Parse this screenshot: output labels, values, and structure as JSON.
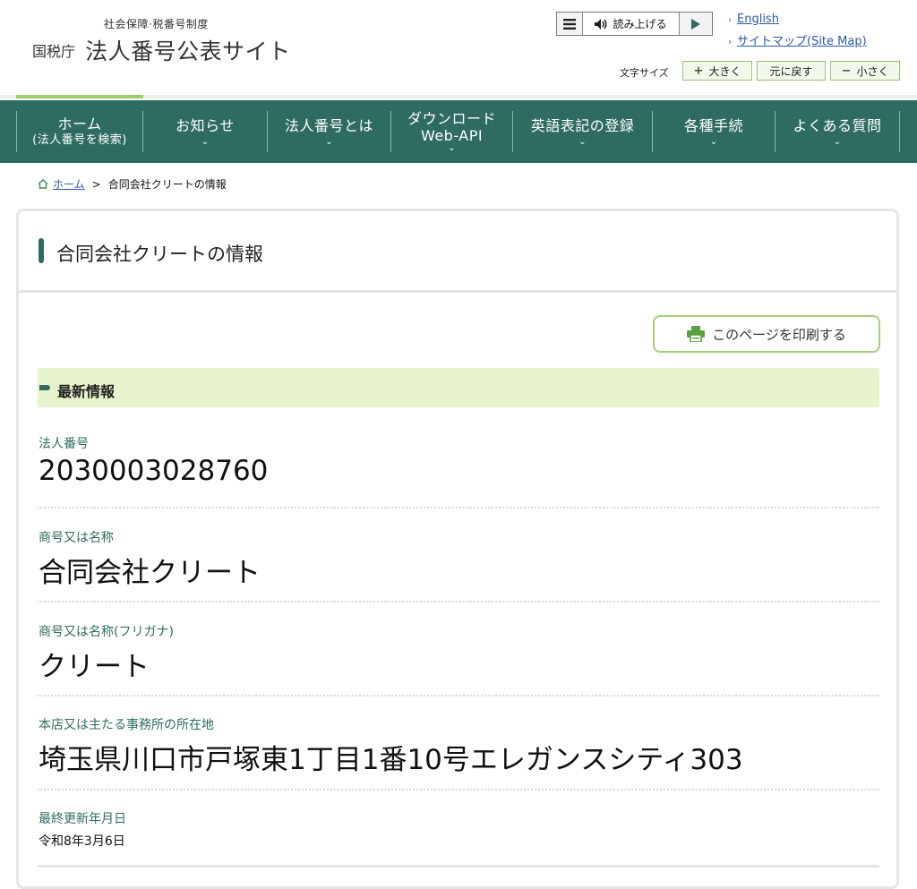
{
  "header": {
    "logo_subtitle": "社会保障·税番号制度",
    "logo_agency": "国税庁",
    "logo_title": "法人番号公表サイト",
    "tts_label": "読み上げる",
    "links": {
      "english": "English",
      "sitemap": "サイトマップ(Site Map)"
    },
    "font_size_label": "文字サイズ",
    "font_size": {
      "large": "大きく",
      "reset": "元に戻す",
      "small": "小さく"
    }
  },
  "nav": {
    "items": [
      {
        "label": "ホーム",
        "sub": "(法人番号を検索)"
      },
      {
        "label": "お知らせ"
      },
      {
        "label": "法人番号とは"
      },
      {
        "label": "ダウンロード",
        "sub": "Web-API"
      },
      {
        "label": "英語表記の登録"
      },
      {
        "label": "各種手続"
      },
      {
        "label": "よくある質問"
      }
    ]
  },
  "breadcrumb": {
    "home": "ホーム",
    "separator": ">",
    "current": "合同会社クリートの情報"
  },
  "page": {
    "title": "合同会社クリートの情報",
    "print_button": "このページを印刷する",
    "section_title": "最新情報",
    "fields": {
      "corporate_number": {
        "label": "法人番号",
        "value": "2030003028760"
      },
      "name": {
        "label": "商号又は名称",
        "value": "合同会社クリート"
      },
      "furigana": {
        "label": "商号又は名称(フリガナ)",
        "value": "クリート"
      },
      "address": {
        "label": "本店又は主たる事務所の所在地",
        "value": "埼玉県川口市戸塚東1丁目1番10号エレガンスシティ303"
      },
      "updated": {
        "label": "最終更新年月日",
        "value": "令和8年3月6日"
      }
    }
  },
  "colors": {
    "nav_bg": "#2e6c62",
    "accent_green": "#9ccf6a",
    "section_bg": "#e7f3cc",
    "label_green": "#2e6c62"
  }
}
